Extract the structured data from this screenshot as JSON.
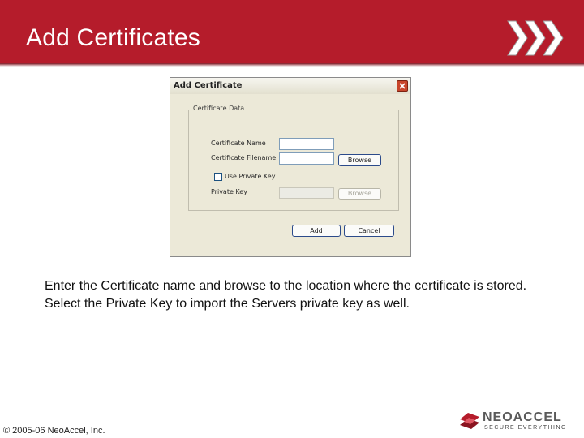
{
  "slide": {
    "title": "Add Certificates",
    "body": "Enter the Certificate name and browse to the location where the certificate is stored. Select the Private Key to import the Servers private key as well.",
    "copyright": "© 2005-06 NeoAccel, Inc."
  },
  "dialog": {
    "title": "Add Certificate",
    "group_title": "Certificate Data",
    "fields": {
      "certificate_name_label": "Certificate Name",
      "certificate_name_value": "",
      "certificate_filename_label": "Certificate Filename",
      "certificate_filename_value": "",
      "use_private_key_label": "Use Private Key",
      "use_private_key_checked": false,
      "private_key_label": "Private Key",
      "private_key_value": ""
    },
    "buttons": {
      "browse": "Browse",
      "browse_private_key": "Browse",
      "add": "Add",
      "cancel": "Cancel"
    }
  },
  "logo": {
    "name": "NEOACCEL",
    "tagline": "SECURE EVERYTHING"
  },
  "colors": {
    "header": "#b51c2b",
    "dialog_bg": "#ece9d8",
    "close_button": "#c8452a"
  }
}
